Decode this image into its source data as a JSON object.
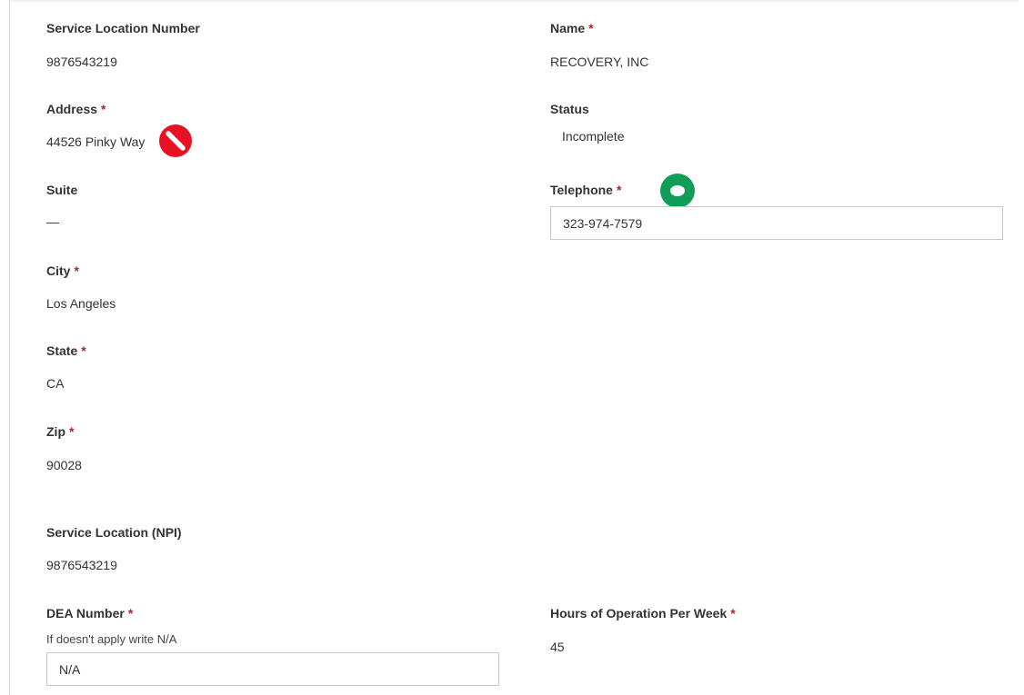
{
  "fields": {
    "service_location_number": {
      "label": "Service Location Number",
      "value": "9876543219"
    },
    "name": {
      "label": "Name",
      "value": "RECOVERY, INC"
    },
    "address": {
      "label": "Address",
      "value": "44526 Pinky Way"
    },
    "status": {
      "label": "Status",
      "value": "Incomplete"
    },
    "suite": {
      "label": "Suite",
      "value": "—"
    },
    "telephone": {
      "label": "Telephone",
      "value": "323-974-7579"
    },
    "city": {
      "label": "City",
      "value": "Los Angeles"
    },
    "state": {
      "label": "State",
      "value": "CA"
    },
    "zip": {
      "label": "Zip",
      "value": "90028"
    },
    "service_location_npi": {
      "label": "Service Location (NPI)",
      "value": "9876543219"
    },
    "dea_number": {
      "label": "DEA Number",
      "hint": "If doesn't apply write N/A",
      "value": "N/A"
    },
    "hours_per_week": {
      "label": "Hours of Operation Per Week",
      "value": "45"
    }
  },
  "required_marker": "*",
  "icons": {
    "address_status_icon": "no-entry-icon",
    "telephone_status_icon": "green-ring-icon"
  },
  "colors": {
    "required": "#a4262c",
    "error_icon": "#e81123",
    "ok_icon": "#0f9d58"
  }
}
